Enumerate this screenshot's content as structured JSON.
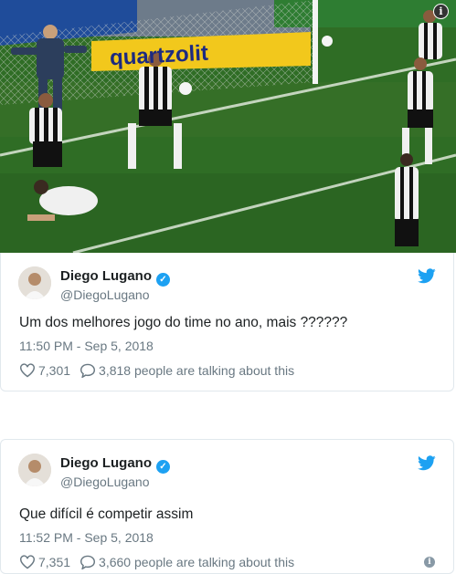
{
  "photo": {
    "ad_board_text": "quartzolit",
    "info_badge": "i"
  },
  "tweets": [
    {
      "name": "Diego Lugano",
      "handle": "@DiegoLugano",
      "text": "Um dos melhores jogo do time no ano,  mais ??????",
      "timestamp": "11:50 PM - Sep 5, 2018",
      "likes": "7,301",
      "talking": "3,818 people are talking about this"
    },
    {
      "name": "Diego Lugano",
      "handle": "@DiegoLugano",
      "text": "Que difícil é competir assim",
      "timestamp": "11:52 PM - Sep 5, 2018",
      "likes": "7,351",
      "talking": "3,660 people are talking about this"
    }
  ],
  "icons": {
    "verified": "verified-badge-icon",
    "twitter": "twitter-bird-icon",
    "like": "heart-icon",
    "reply": "speech-bubble-icon",
    "info": "info-icon"
  },
  "colors": {
    "twitter_blue": "#1da1f2",
    "muted_text": "#697882",
    "pitch_green": "#2f6d25"
  }
}
